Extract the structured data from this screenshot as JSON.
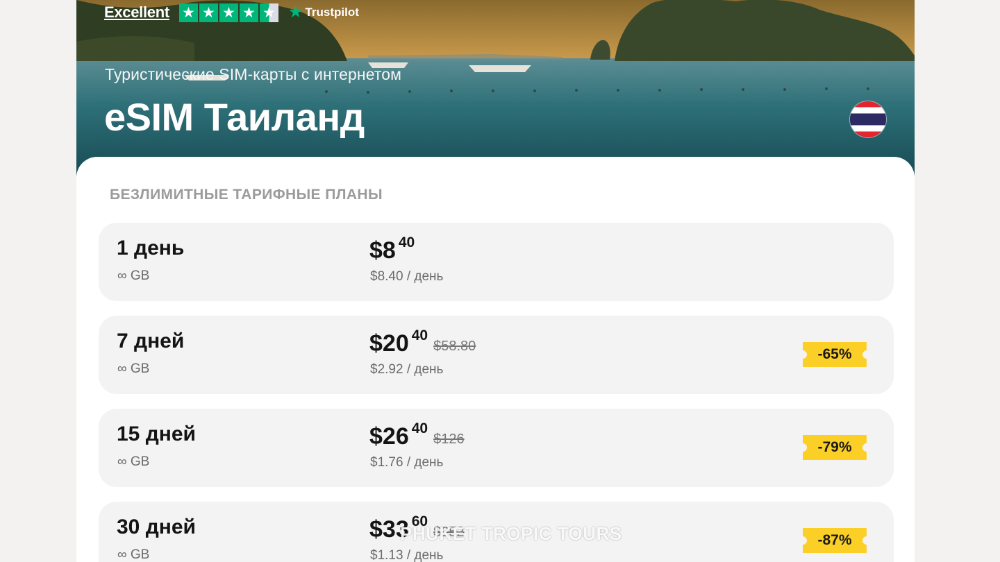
{
  "trustpilot": {
    "rating_label": "Excellent",
    "stars_rating": 4.5,
    "brand": "Trustpilot",
    "accent_color": "#00b67a"
  },
  "hero": {
    "subtitle": "Туристические SIM-карты с интернетом",
    "title": "eSIM Таиланд",
    "flag_icon": "thailand-flag-icon"
  },
  "section": {
    "title": "БЕЗЛИМИТНЫЕ ТАРИФНЫЕ ПЛАНЫ"
  },
  "plans": [
    {
      "name": "1 день",
      "data": "∞ GB",
      "price_main": "$8",
      "price_cents": "40",
      "price_old": "",
      "per_day": "$8.40 / день",
      "discount": ""
    },
    {
      "name": "7 дней",
      "data": "∞ GB",
      "price_main": "$20",
      "price_cents": "40",
      "price_old": "$58.80",
      "per_day": "$2.92 / день",
      "discount": "-65%"
    },
    {
      "name": "15 дней",
      "data": "∞ GB",
      "price_main": "$26",
      "price_cents": "40",
      "price_old": "$126",
      "per_day": "$1.76 / день",
      "discount": "-79%"
    },
    {
      "name": "30 дней",
      "data": "∞ GB",
      "price_main": "$33",
      "price_cents": "60",
      "price_old": "$252",
      "per_day": "$1.13 / день",
      "discount": "-87%"
    }
  ],
  "watermark": "PHUKET TROPIC TOURS",
  "colors": {
    "discount_badge": "#fbcf26",
    "plan_card": "#f3f3f3",
    "page_background": "#f3f2f0"
  }
}
